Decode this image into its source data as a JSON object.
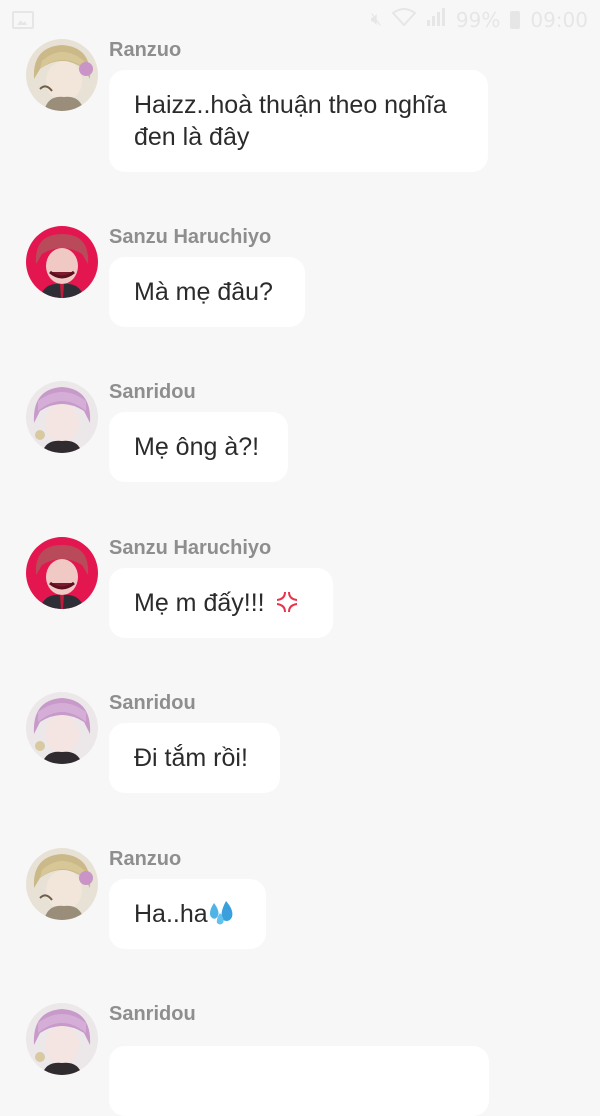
{
  "status_bar": {
    "battery_text": "99%",
    "time": "09:00",
    "icons": [
      "image-icon",
      "mute-icon",
      "wifi-icon",
      "signal-icon",
      "battery-icon"
    ]
  },
  "colors": {
    "background": "#f7f7f7",
    "bubble": "#ffffff",
    "sender_name": "#8e8e8e",
    "message_text": "#2b2b2b"
  },
  "messages": [
    {
      "sender": "Ranzuo",
      "avatar": "ranzuo-avatar",
      "text": "Haizz..hoà thuận theo nghĩa",
      "text2": "đen là đây"
    },
    {
      "sender": "Sanzu Haruchiyo",
      "avatar": "sanzu-avatar",
      "text": "Mà mẹ đâu?"
    },
    {
      "sender": "Sanridou",
      "avatar": "sanridou-avatar",
      "text": "Mẹ ông à?!"
    },
    {
      "sender": "Sanzu Haruchiyo",
      "avatar": "sanzu-avatar",
      "text": "Mẹ m đấy!!!",
      "emoji": "anger-emoji"
    },
    {
      "sender": "Sanridou",
      "avatar": "sanridou-avatar",
      "text": "Đi tắm rồi!"
    },
    {
      "sender": "Ranzuo",
      "avatar": "ranzuo-avatar",
      "text": "Ha..ha",
      "emoji": "sweat-droplets-emoji"
    },
    {
      "sender": "Sanridou",
      "avatar": "sanridou-avatar",
      "text": ""
    }
  ]
}
